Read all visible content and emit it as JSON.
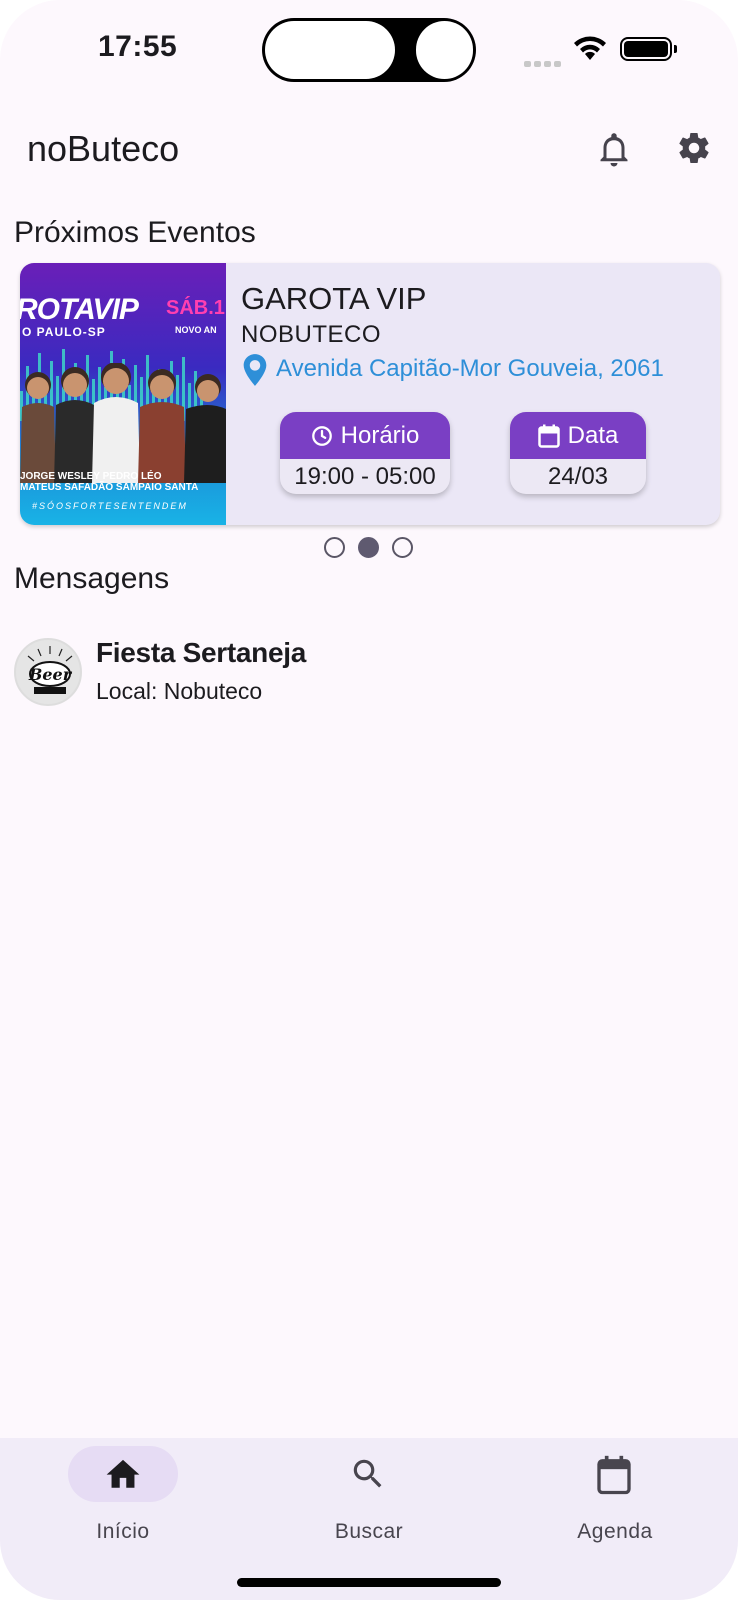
{
  "status_bar": {
    "time": "17:55"
  },
  "app_bar": {
    "title": "noButeco"
  },
  "sections": {
    "events": "Próximos Eventos",
    "messages": "Mensagens"
  },
  "event_card": {
    "name": "GAROTA VIP",
    "venue": "NOBUTECO",
    "address": "Avenida Capitão-Mor Gouveia, 2061",
    "time_label": "Horário",
    "time_value": "19:00 - 05:00",
    "date_label": "Data",
    "date_value": "24/03",
    "poster": {
      "title": "ROTAVIP",
      "sab": "SÁB.1",
      "city": "O PAULO-SP",
      "novo": "NOVO AN",
      "names_line1": "JORGE   WESLEY  PEDRO    LÉO",
      "names_line2": "MATEUS SAFADÃO SAMPAIO SANTA",
      "hashtag": "#SÓOSFORTESENTENDEM"
    }
  },
  "carousel": {
    "count": 3,
    "active_index": 1
  },
  "messages": [
    {
      "title": "Fiesta Sertaneja",
      "subtitle": "Local: Nobuteco",
      "avatar_text": "Beer"
    }
  ],
  "bottom_nav": {
    "items": [
      {
        "label": "Início",
        "icon": "home-icon",
        "active": true
      },
      {
        "label": "Buscar",
        "icon": "search-icon",
        "active": false
      },
      {
        "label": "Agenda",
        "icon": "calendar-icon",
        "active": false
      }
    ]
  },
  "colors": {
    "accent": "#7a3fc4",
    "link": "#2e8fd8",
    "card_bg": "#ebe7f6",
    "nav_bg": "#f1ecf8",
    "active_indicator": "#e6dcf4"
  }
}
